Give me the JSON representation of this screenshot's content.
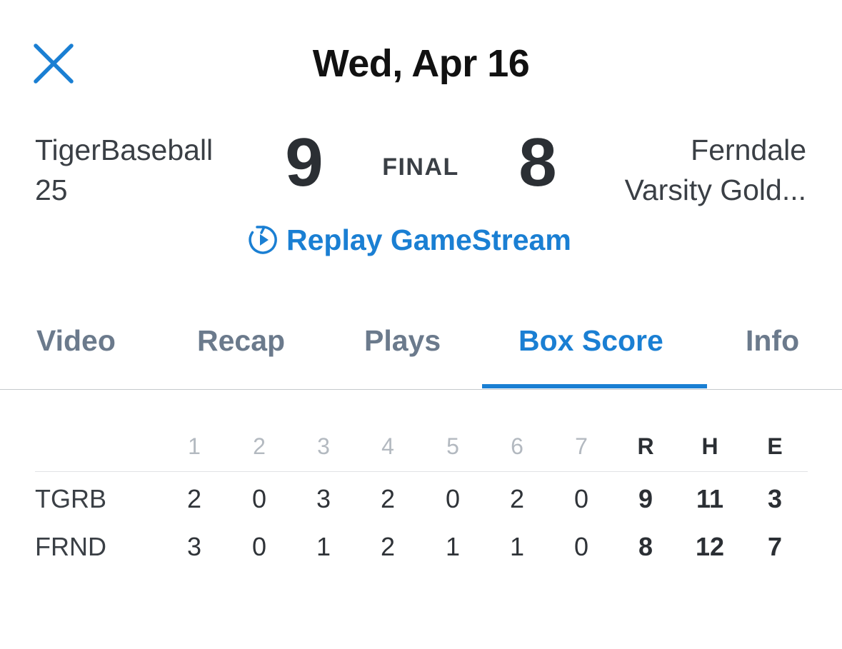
{
  "header": {
    "date": "Wed, Apr 16",
    "close_icon": "close-icon"
  },
  "game": {
    "home_team": {
      "line1": "TigerBaseball",
      "line2": "25",
      "score": "9"
    },
    "away_team": {
      "line1": "Ferndale",
      "line2": "Varsity Gold...",
      "score": "8"
    },
    "status": "FINAL"
  },
  "replay": {
    "label": "Replay GameStream",
    "icon": "replay-icon"
  },
  "tabs": [
    {
      "label": "Video"
    },
    {
      "label": "Recap"
    },
    {
      "label": "Plays"
    },
    {
      "label": "Box Score",
      "active": true
    },
    {
      "label": "Info"
    }
  ],
  "box_score": {
    "innings": [
      "1",
      "2",
      "3",
      "4",
      "5",
      "6",
      "7"
    ],
    "totals_headers": [
      "R",
      "H",
      "E"
    ],
    "rows": [
      {
        "team": "TGRB",
        "innings": [
          "2",
          "0",
          "3",
          "2",
          "0",
          "2",
          "0"
        ],
        "totals": [
          "9",
          "11",
          "3"
        ]
      },
      {
        "team": "FRND",
        "innings": [
          "3",
          "0",
          "1",
          "2",
          "1",
          "1",
          "0"
        ],
        "totals": [
          "8",
          "12",
          "7"
        ]
      }
    ]
  },
  "colors": {
    "accent": "#1a7fd3",
    "text_dark": "#2b2f34",
    "tab_inactive": "#6b7a8c",
    "header_muted": "#b3b9c0"
  }
}
